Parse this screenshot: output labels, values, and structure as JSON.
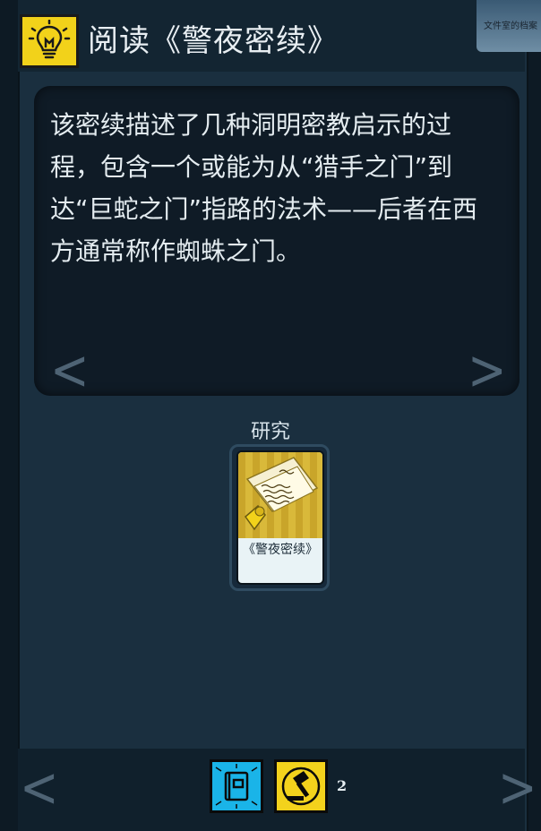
{
  "header": {
    "title": "阅读《警夜密续》",
    "icon": "lightbulb-icon",
    "icon_color": "#f2d21a"
  },
  "corner_card": {
    "label": "文件室的档案"
  },
  "description": {
    "text": "该密续描述了几种洞明密教启示的过程，包含一个或能为从“猎手之门”到达“巨蛇之门”指路的法术——后者在西方通常称作蜘蛛之门。"
  },
  "nav": {
    "prev": "<",
    "next": ">"
  },
  "slot": {
    "label": "研究"
  },
  "card": {
    "label": "《警夜密续》",
    "art_icon": "manuscript-icon"
  },
  "footer": {
    "aspects": [
      {
        "name": "lore-book-icon",
        "color": "#1ab4e8"
      },
      {
        "name": "forge-hammer-icon",
        "color": "#f3d21c"
      }
    ],
    "aspect_count": "2"
  }
}
